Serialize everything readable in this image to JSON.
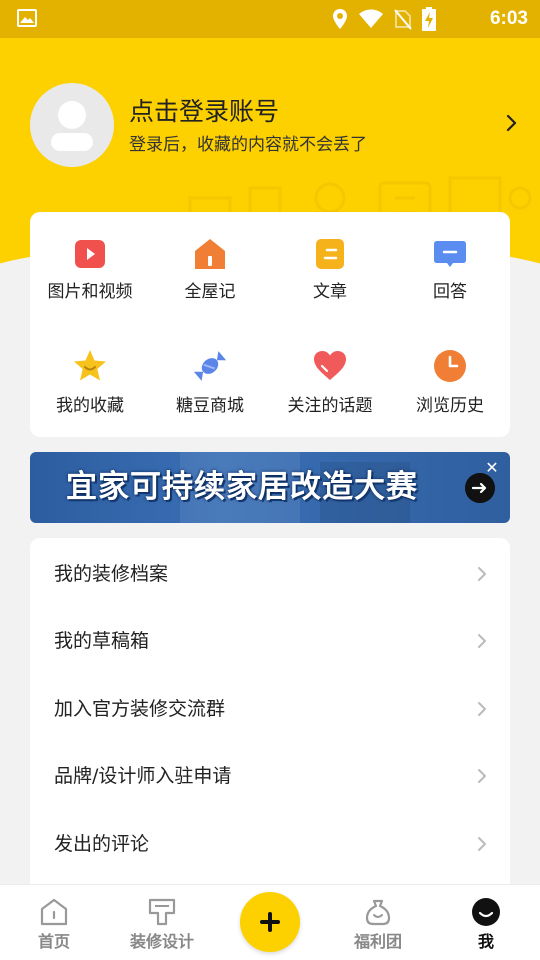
{
  "status_bar": {
    "time": "6:03",
    "icons": [
      "gallery-icon",
      "location-icon",
      "wifi-icon",
      "no-sim-icon",
      "battery-charging-icon"
    ]
  },
  "profile": {
    "title": "点击登录账号",
    "subtitle": "登录后，收藏的内容就不会丢了"
  },
  "features": [
    {
      "label": "图片和视频",
      "icon": "play-video-icon",
      "color": "#f0514d"
    },
    {
      "label": "全屋记",
      "icon": "house-icon",
      "color": "#f07f35"
    },
    {
      "label": "文章",
      "icon": "article-icon",
      "color": "#f6b21b"
    },
    {
      "label": "回答",
      "icon": "answer-bubble-icon",
      "color": "#5b8df0"
    },
    {
      "label": "我的收藏",
      "icon": "star-icon",
      "color": "#f7c21c"
    },
    {
      "label": "糖豆商城",
      "icon": "candy-icon",
      "color": "#5b86e8"
    },
    {
      "label": "关注的话题",
      "icon": "heart-icon",
      "color": "#f05a5a"
    },
    {
      "label": "浏览历史",
      "icon": "clock-icon",
      "color": "#f07f35"
    }
  ],
  "banner": {
    "text": "宜家可持续家居改造大赛"
  },
  "menu": [
    {
      "label": "我的装修档案"
    },
    {
      "label": "我的草稿箱"
    },
    {
      "label": "加入官方装修交流群"
    },
    {
      "label": "品牌/设计师入驻申请"
    },
    {
      "label": "发出的评论"
    }
  ],
  "bottom_nav": [
    {
      "label": "首页",
      "icon": "home-icon"
    },
    {
      "label": "装修设计",
      "icon": "design-icon"
    },
    {
      "label": "福利团",
      "icon": "welfare-bag-icon"
    },
    {
      "label": "我",
      "icon": "me-icon",
      "active": true
    }
  ],
  "colors": {
    "brand_yellow": "#fdd000",
    "status_bar": "#e3b200",
    "banner_blue": "#2d5da0"
  }
}
